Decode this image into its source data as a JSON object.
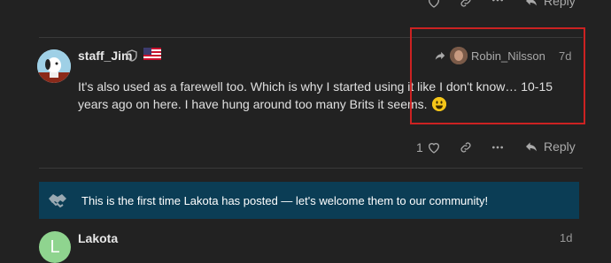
{
  "top_actions": {
    "reply_label": "Reply"
  },
  "post": {
    "username": "staff_Jim",
    "reply_to_user": "Robin_Nilsson",
    "date": "7d",
    "text": "It's also used as a farewell too. Which is why I started using it like I don't know… 10-15 years ago on here. I have hung around too many Brits it seems.",
    "like_count": "1",
    "reply_label": "Reply"
  },
  "notice": {
    "text": "This is the first time Lakota has posted — let's welcome them to our community!"
  },
  "next_post": {
    "avatar_letter": "L",
    "username": "Lakota",
    "date": "1d"
  },
  "colors": {
    "background": "#222222",
    "notice_bg": "#0b3d55",
    "highlight": "#cc2222"
  }
}
